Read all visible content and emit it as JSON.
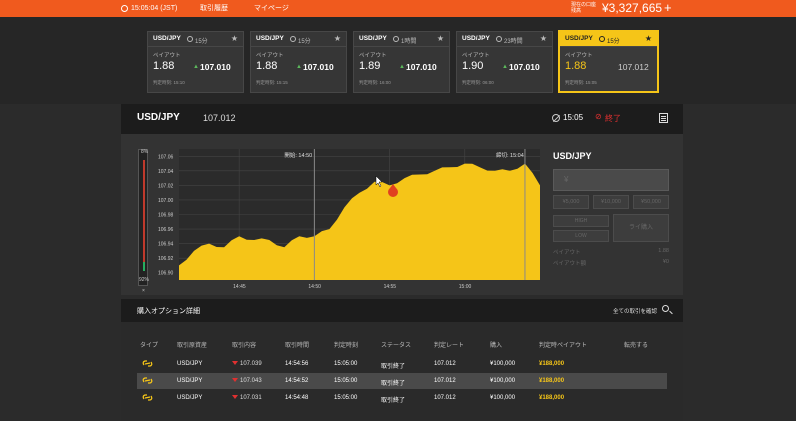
{
  "topbar": {
    "time": "15:05:04 (JST)",
    "nav": [
      "取引履歴",
      "マイページ"
    ],
    "balance_label": "現在の口座残高",
    "balance": "¥3,327,665",
    "add": "+"
  },
  "tiles": [
    {
      "pair": "USD/JPY",
      "duration": "15分",
      "payout_label": "ペイアウト",
      "payout": "1.88",
      "rate": "107.010",
      "judge": "判定時刻: 15:10",
      "active": false
    },
    {
      "pair": "USD/JPY",
      "duration": "15分",
      "payout_label": "ペイアウト",
      "payout": "1.88",
      "rate": "107.010",
      "judge": "判定時刻: 15:15",
      "active": false
    },
    {
      "pair": "USD/JPY",
      "duration": "1時間",
      "payout_label": "ペイアウト",
      "payout": "1.89",
      "rate": "107.010",
      "judge": "判定時刻: 16:00",
      "active": false
    },
    {
      "pair": "USD/JPY",
      "duration": "23時間",
      "payout_label": "ペイアウト",
      "payout": "1.90",
      "rate": "107.010",
      "judge": "判定時刻: 06:00",
      "active": false
    },
    {
      "pair": "USD/JPY",
      "duration": "15分",
      "payout_label": "ペイアウト",
      "payout": "1.88",
      "rate": "107.012",
      "judge": "判定時刻: 15:05",
      "active": true
    }
  ],
  "asset": {
    "pair": "USD/JPY",
    "rate": "107.012",
    "expiry": "15:05",
    "status": "終了"
  },
  "gauge": {
    "top": "8%",
    "bottom": "92%",
    "close": "×",
    "high_pct": 8,
    "low_pct": 92
  },
  "chart_data": {
    "type": "area",
    "title": "",
    "xlabel": "",
    "ylabel": "",
    "x_ticks": [
      "14:45",
      "14:50",
      "14:55",
      "15:00"
    ],
    "y_ticks": [
      "107.06",
      "107.04",
      "107.02",
      "107.00",
      "106.98",
      "106.96",
      "106.94",
      "106.92",
      "106.90"
    ],
    "ylim": [
      106.89,
      107.07
    ],
    "annotations": {
      "start": "開始: 14:50",
      "end": "締切: 15:04"
    },
    "series": [
      {
        "color": "#f5c518",
        "x": [
          "14:41",
          "14:42",
          "14:43",
          "14:44",
          "14:45",
          "14:46",
          "14:47",
          "14:48",
          "14:49",
          "14:50",
          "14:51",
          "14:52",
          "14:53",
          "14:54",
          "14:55",
          "14:56",
          "14:57",
          "14:58",
          "14:59",
          "15:00",
          "15:01",
          "15:02",
          "15:03",
          "15:04",
          "15:05"
        ],
        "values": [
          106.91,
          106.93,
          106.94,
          106.935,
          106.95,
          106.945,
          106.945,
          106.935,
          106.95,
          106.95,
          106.96,
          106.99,
          107.01,
          107.025,
          107.02,
          107.03,
          107.035,
          107.04,
          107.045,
          107.05,
          107.045,
          107.04,
          107.04,
          107.05,
          107.02
        ]
      }
    ]
  },
  "trade": {
    "title": "USD/JPY",
    "amount_placeholder": "¥",
    "amounts": [
      "¥5,000",
      "¥10,000",
      "¥50,000"
    ],
    "high": "HIGH",
    "low": "LOW",
    "buy": "ライ購入",
    "payout_label": "ペイアウト",
    "payout_value": "1.88",
    "payout_amount_label": "ペイアウト額",
    "payout_amount_value": "¥0"
  },
  "details": {
    "title": "購入オプション詳細",
    "link": "全ての取引を確認"
  },
  "table": {
    "headers": [
      "タイプ",
      "取引原資産",
      "取引内容",
      "取引時間",
      "判定時刻",
      "ステータス",
      "判定レート",
      "購入",
      "判定時ペイアウト",
      "転売する"
    ],
    "rows": [
      {
        "asset": "USD/JPY",
        "content": "107.039",
        "time": "14:54:56",
        "judge": "15:05:00",
        "status": "取引終了",
        "rate": "107.012",
        "buy": "¥100,000",
        "payout": "¥188,000"
      },
      {
        "asset": "USD/JPY",
        "content": "107.043",
        "time": "14:54:52",
        "judge": "15:05:00",
        "status": "取引終了",
        "rate": "107.012",
        "buy": "¥100,000",
        "payout": "¥188,000"
      },
      {
        "asset": "USD/JPY",
        "content": "107.031",
        "time": "14:54:48",
        "judge": "15:05:00",
        "status": "取引終了",
        "rate": "107.012",
        "buy": "¥100,000",
        "payout": "¥188,000"
      }
    ]
  }
}
